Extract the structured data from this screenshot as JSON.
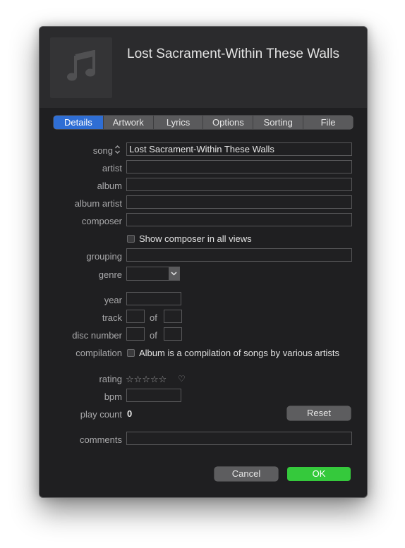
{
  "header": {
    "song_title": "Lost Sacrament-Within These Walls",
    "artwork_icon": "music-note-icon"
  },
  "tabs": [
    {
      "label": "Details",
      "active": true
    },
    {
      "label": "Artwork"
    },
    {
      "label": "Lyrics"
    },
    {
      "label": "Options"
    },
    {
      "label": "Sorting"
    },
    {
      "label": "File"
    }
  ],
  "fields": {
    "song": {
      "label": "song",
      "value": "Lost Sacrament-Within These Walls",
      "sort_icon": "up-down-chevron-icon"
    },
    "artist": {
      "label": "artist",
      "value": ""
    },
    "album": {
      "label": "album",
      "value": ""
    },
    "album_artist": {
      "label": "album artist",
      "value": ""
    },
    "composer": {
      "label": "composer",
      "value": ""
    },
    "show_composer": {
      "label": "Show composer in all views",
      "checked": false
    },
    "grouping": {
      "label": "grouping",
      "value": ""
    },
    "genre": {
      "label": "genre",
      "value": ""
    },
    "year": {
      "label": "year",
      "value": ""
    },
    "track": {
      "label": "track",
      "of_label": "of",
      "value": "",
      "total": ""
    },
    "disc_number": {
      "label": "disc number",
      "of_label": "of",
      "value": "",
      "total": ""
    },
    "compilation": {
      "label": "compilation",
      "checkbox_label": "Album is a compilation of songs by various artists",
      "checked": false
    },
    "rating": {
      "label": "rating",
      "stars": "☆☆☆☆☆",
      "heart": "♡",
      "value": 0
    },
    "bpm": {
      "label": "bpm",
      "value": ""
    },
    "play_count": {
      "label": "play count",
      "value": "0",
      "reset_label": "Reset"
    },
    "comments": {
      "label": "comments",
      "value": ""
    }
  },
  "buttons": {
    "cancel": "Cancel",
    "ok": "OK"
  },
  "colors": {
    "window_bg": "#1f1f21",
    "header_bg": "#2b2b2d",
    "active_tab": "#2f6ed4",
    "ok_button": "#35c93c"
  }
}
